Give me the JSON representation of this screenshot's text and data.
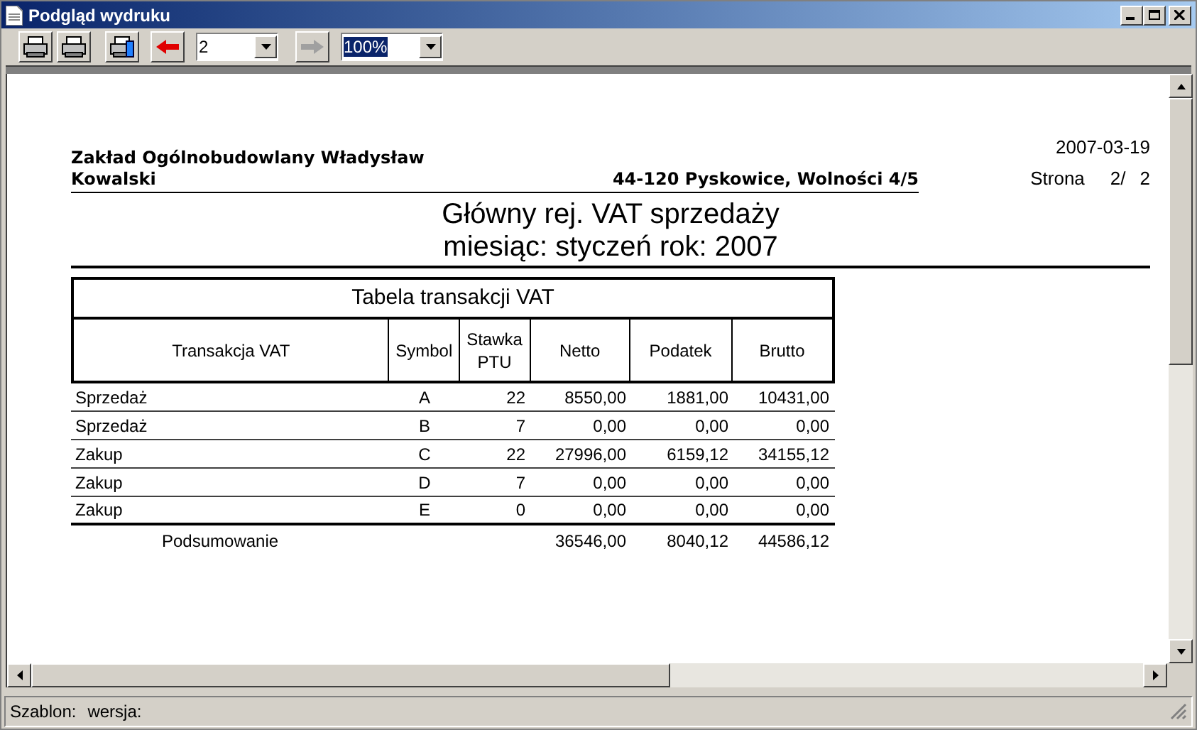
{
  "window": {
    "title": "Podgląd wydruku"
  },
  "toolbar": {
    "page": "2",
    "zoom": "100%",
    "prev_disabled": false,
    "next_disabled": true
  },
  "document": {
    "company_lines": [
      "Zakład Ogólnobudowlany  Władysław",
      "Kowalski"
    ],
    "address": "44-120 Pyskowice, Wolności 4/5",
    "date": "2007-03-19",
    "page_label": "Strona",
    "page_number": "2/",
    "page_count": "2",
    "title_lines": [
      "Główny rej. VAT sprzedaży",
      "miesiąc: styczeń rok: 2007"
    ],
    "table": {
      "caption": "Tabela transakcji VAT",
      "columns": [
        "Transakcja VAT",
        "Symbol",
        "Stawka PTU",
        "Netto",
        "Podatek",
        "Brutto"
      ],
      "rows": [
        [
          "Sprzedaż",
          "A",
          "22",
          "8550,00",
          "1881,00",
          "10431,00"
        ],
        [
          "Sprzedaż",
          "B",
          "7",
          "0,00",
          "0,00",
          "0,00"
        ],
        [
          "Zakup",
          "C",
          "22",
          "27996,00",
          "6159,12",
          "34155,12"
        ],
        [
          "Zakup",
          "D",
          "7",
          "0,00",
          "0,00",
          "0,00"
        ],
        [
          "Zakup",
          "E",
          "0",
          "0,00",
          "0,00",
          "0,00"
        ]
      ],
      "summary": {
        "label": "Podsumowanie",
        "netto": "36546,00",
        "podatek": "8040,12",
        "brutto": "44586,12"
      }
    }
  },
  "status_bar": {
    "template_label": "Szablon:",
    "version_label": "wersja:"
  }
}
